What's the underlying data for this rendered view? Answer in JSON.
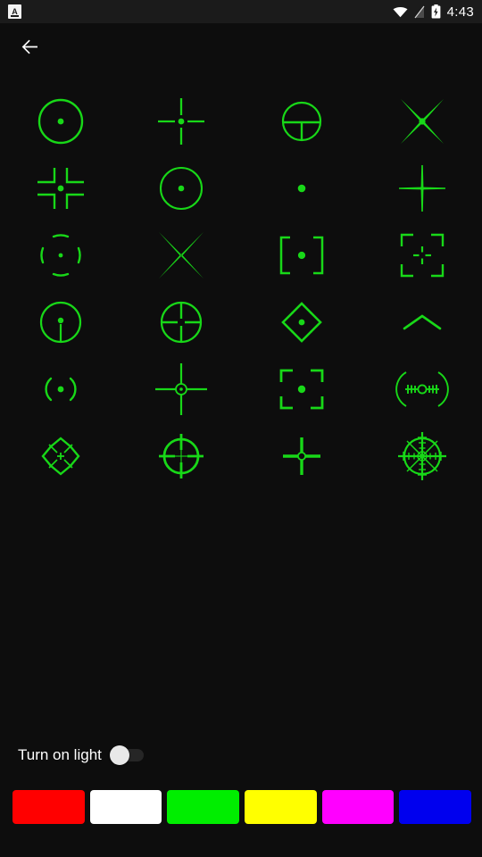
{
  "status_bar": {
    "app_notification_icon": "app-notification-icon",
    "wifi_icon": "wifi-icon",
    "no_sim_icon": "no-sim-signal-icon",
    "battery_charging_icon": "battery-charging-icon",
    "time": "4:43",
    "background_color": "#1b1b1b"
  },
  "action_bar": {
    "back_icon": "arrow-left-icon",
    "title": ""
  },
  "theme": {
    "background_color": "#0d0d0d",
    "reticle_color": "#18d818",
    "text_color": "#ffffff"
  },
  "reticle_grid": {
    "columns": 4,
    "rows": 6,
    "items": [
      {
        "index": 1,
        "name": "reticle-dotted-circle-dot",
        "icon": "crosshair-circle-segments-dot-icon"
      },
      {
        "index": 2,
        "name": "reticle-cross-gap-dot",
        "icon": "crosshair-cross-gap-dot-icon"
      },
      {
        "index": 3,
        "name": "reticle-circle-t-bar",
        "icon": "crosshair-circle-tbar-icon"
      },
      {
        "index": 4,
        "name": "reticle-x-dot",
        "icon": "crosshair-x-dot-icon"
      },
      {
        "index": 5,
        "name": "reticle-four-corner-brackets-dot",
        "icon": "crosshair-corner-brackets-dot-icon"
      },
      {
        "index": 6,
        "name": "reticle-circle-dot",
        "icon": "crosshair-circle-dot-icon"
      },
      {
        "index": 7,
        "name": "reticle-single-dot",
        "icon": "crosshair-dot-icon"
      },
      {
        "index": 8,
        "name": "reticle-thin-cross-taper",
        "icon": "crosshair-thin-cross-icon"
      },
      {
        "index": 9,
        "name": "reticle-arcs-parens-dot",
        "icon": "crosshair-arcs-parens-dot-icon"
      },
      {
        "index": 10,
        "name": "reticle-x-plain",
        "icon": "crosshair-x-icon"
      },
      {
        "index": 11,
        "name": "reticle-square-brackets-dot",
        "icon": "crosshair-square-brackets-dot-icon"
      },
      {
        "index": 12,
        "name": "reticle-corner-frame-small-cross",
        "icon": "crosshair-corner-frame-cross-icon"
      },
      {
        "index": 13,
        "name": "reticle-circle-dot-stem",
        "icon": "crosshair-circle-dot-stem-icon"
      },
      {
        "index": 14,
        "name": "reticle-circle-full-cross",
        "icon": "crosshair-circle-cross-icon"
      },
      {
        "index": 15,
        "name": "reticle-diamond-chevrons-dot",
        "icon": "crosshair-diamond-chevrons-dot-icon"
      },
      {
        "index": 16,
        "name": "reticle-chevron-caret",
        "icon": "crosshair-chevron-icon"
      },
      {
        "index": 17,
        "name": "reticle-parens-dot",
        "icon": "crosshair-parens-dot-icon"
      },
      {
        "index": 18,
        "name": "reticle-long-cross-ring",
        "icon": "crosshair-long-cross-ring-icon"
      },
      {
        "index": 19,
        "name": "reticle-corner-brackets-dot",
        "icon": "crosshair-brackets-dot-icon"
      },
      {
        "index": 20,
        "name": "reticle-arc-ticks-ring",
        "icon": "crosshair-arc-ticks-ring-icon"
      },
      {
        "index": 21,
        "name": "reticle-rosette-cross",
        "icon": "crosshair-rosette-cross-icon"
      },
      {
        "index": 22,
        "name": "reticle-ring-extended-cross",
        "icon": "crosshair-ring-extended-cross-icon"
      },
      {
        "index": 23,
        "name": "reticle-bold-cross-ring",
        "icon": "crosshair-bold-cross-ring-icon"
      },
      {
        "index": 24,
        "name": "reticle-scope-complex",
        "icon": "crosshair-scope-complex-icon"
      }
    ]
  },
  "light_control": {
    "label": "Turn on light",
    "toggle_state": "off",
    "toggle_knob_color": "#e8e8e8",
    "toggle_track_color": "#262626"
  },
  "color_swatches": [
    {
      "name": "color-swatch-red",
      "label": "Red",
      "color": "#ff0000"
    },
    {
      "name": "color-swatch-white",
      "label": "White",
      "color": "#ffffff"
    },
    {
      "name": "color-swatch-green",
      "label": "Green",
      "color": "#00ee00"
    },
    {
      "name": "color-swatch-yellow",
      "label": "Yellow",
      "color": "#ffff00"
    },
    {
      "name": "color-swatch-magenta",
      "label": "Magenta",
      "color": "#ff00ff"
    },
    {
      "name": "color-swatch-blue",
      "label": "Blue",
      "color": "#0000ee"
    }
  ]
}
